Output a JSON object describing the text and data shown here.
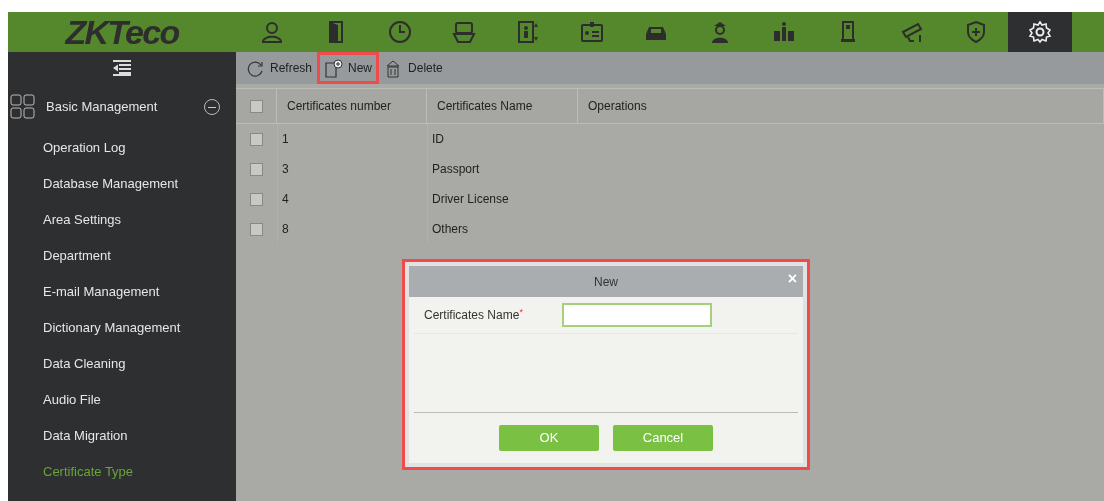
{
  "header": {
    "logo": "ZKTeco",
    "modules": [
      {
        "selected": false
      },
      {
        "selected": false
      },
      {
        "selected": false
      },
      {
        "selected": false
      },
      {
        "selected": false
      },
      {
        "selected": false
      },
      {
        "selected": false
      },
      {
        "selected": false
      },
      {
        "selected": false
      },
      {
        "selected": false
      },
      {
        "selected": false
      },
      {
        "selected": false
      },
      {
        "selected": true
      }
    ]
  },
  "sidebar": {
    "group": {
      "label": "Basic Management",
      "expanded": true
    },
    "items": [
      {
        "label": "Operation Log",
        "selected": false
      },
      {
        "label": "Database Management",
        "selected": false
      },
      {
        "label": "Area Settings",
        "selected": false
      },
      {
        "label": "Department",
        "selected": false
      },
      {
        "label": "E-mail Management",
        "selected": false
      },
      {
        "label": "Dictionary Management",
        "selected": false
      },
      {
        "label": "Data Cleaning",
        "selected": false
      },
      {
        "label": "Audio File",
        "selected": false
      },
      {
        "label": "Data Migration",
        "selected": false
      },
      {
        "label": "Certificate Type",
        "selected": true
      }
    ]
  },
  "toolbar": {
    "buttons": [
      {
        "label": "Refresh",
        "highlighted": false
      },
      {
        "label": "New",
        "highlighted": true
      },
      {
        "label": "Delete",
        "highlighted": false
      }
    ]
  },
  "table": {
    "all_checked": false,
    "columns": [
      "Certificates number",
      "Certificates Name",
      "Operations"
    ],
    "rows": [
      {
        "checked": false,
        "cells": [
          "1",
          "ID"
        ]
      },
      {
        "checked": false,
        "cells": [
          "3",
          "Passport"
        ]
      },
      {
        "checked": false,
        "cells": [
          "4",
          "Driver License"
        ]
      },
      {
        "checked": false,
        "cells": [
          "8",
          "Others"
        ]
      }
    ]
  },
  "dialog": {
    "title": "New",
    "close": "×",
    "field": {
      "label": "Certificates Name",
      "required_mark": "*"
    },
    "buttons": [
      "OK",
      "Cancel"
    ],
    "highlighted": true
  }
}
